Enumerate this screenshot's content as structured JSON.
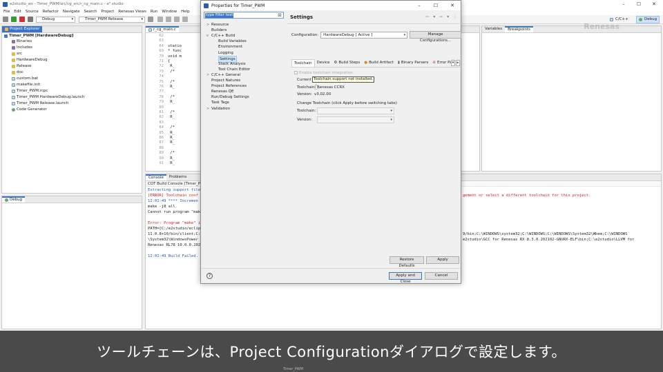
{
  "ide": {
    "title": "e2studio_ws - Timer_PWM/src/cg_src/r_cg_main.c - e² studio",
    "menu": [
      "File",
      "Edit",
      "Source",
      "Refactor",
      "Navigate",
      "Search",
      "Project",
      "Renesas Views",
      "Run",
      "Window",
      "Help"
    ],
    "toolbar": {
      "build_config": "Debug",
      "launch_config": "Timer_PWM Release",
      "perspective_cpp": "C/C++",
      "perspective_debug": "Debug"
    },
    "project_explorer": {
      "tab": "Project Explorer",
      "items": [
        {
          "label": "Timer_PWM [HardwareDebug]",
          "icon": "project-icon"
        },
        {
          "label": "Binaries",
          "icon": "binaries-icon"
        },
        {
          "label": "Includes",
          "icon": "includes-icon"
        },
        {
          "label": "src",
          "icon": "folder-icon"
        },
        {
          "label": "HardwareDebug",
          "icon": "folder-icon"
        },
        {
          "label": "Release",
          "icon": "folder-icon"
        },
        {
          "label": "doc",
          "icon": "folder-icon"
        },
        {
          "label": "custom.bat",
          "icon": "file-icon"
        },
        {
          "label": "makefile.init",
          "icon": "file-icon"
        },
        {
          "label": "Timer_PWM.rcpc",
          "icon": "file-icon"
        },
        {
          "label": "Timer_PWM HardwareDebug.launch",
          "icon": "file-icon"
        },
        {
          "label": "Timer_PWM Release.launch",
          "icon": "file-icon"
        },
        {
          "label": "Code Generator",
          "icon": "gear-icon"
        }
      ]
    },
    "debug_panel": {
      "tab": "Debug"
    },
    "editor": {
      "tab": "r_cg_main.c",
      "lines": [
        {
          "n": "62",
          "code": ""
        },
        {
          "n": "63",
          "code": ""
        },
        {
          "n": "64",
          "code": "statio"
        },
        {
          "n": "69",
          "code": "* func"
        },
        {
          "n": "70",
          "code": "void m"
        },
        {
          "n": "71",
          "code": "{"
        },
        {
          "n": "72",
          "code": "  R_"
        },
        {
          "n": "73",
          "code": "  /*"
        },
        {
          "n": "74",
          "code": ""
        },
        {
          "n": "75",
          "code": "  /*"
        },
        {
          "n": "76",
          "code": "  R_"
        },
        {
          "n": "77",
          "code": ""
        },
        {
          "n": "78",
          "code": "  /*"
        },
        {
          "n": "79",
          "code": "  R_"
        },
        {
          "n": "80",
          "code": ""
        },
        {
          "n": "81",
          "code": "  /*"
        },
        {
          "n": "82",
          "code": "  R_"
        },
        {
          "n": "83",
          "code": ""
        },
        {
          "n": "84",
          "code": "  /*"
        },
        {
          "n": "85",
          "code": "  R_"
        },
        {
          "n": "86",
          "code": "  R_"
        },
        {
          "n": "87",
          "code": "  R_"
        },
        {
          "n": "88",
          "code": ""
        },
        {
          "n": "89",
          "code": "  /*"
        },
        {
          "n": "90",
          "code": "  R_"
        },
        {
          "n": "91",
          "code": "  R_"
        }
      ]
    },
    "right_panel": {
      "tab1": "Variables",
      "tab2": "Breakpoints"
    },
    "console": {
      "tab1": "Console",
      "tab2": "Problems",
      "header": "CDT Build Console [Timer_PWM]",
      "lines": [
        {
          "text": "Extracting support file",
          "style": "blue"
        },
        {
          "text": "[ERROR] Toolchain conf",
          "style": "red"
        },
        {
          "text": "12:01:49 **** Incremen",
          "style": "blue"
        },
        {
          "text": "make -j8 all",
          "style": "black"
        },
        {
          "text": "Cannot run program \"mak",
          "style": "black"
        },
        {
          "text": "",
          "style": "black"
        },
        {
          "text": "Error: Program \"make\" i",
          "style": "red"
        },
        {
          "text": "PATH=[C:/e2studio/eclip",
          "style": "black"
        },
        {
          "text": "11.0.8+10/bin/client;C:",
          "style": "black"
        },
        {
          "text": "\\System32\\WindowsPower",
          "style": "black"
        },
        {
          "text": "Renesas RL78 10.0.0.202",
          "style": "black"
        },
        {
          "text": "",
          "style": "black"
        },
        {
          "text": "12:01:49 Build Failed.",
          "style": "blue"
        }
      ],
      "right_lines": [
        {
          "text": "gement or select a different toolchain for this project.",
          "style": "red"
        },
        {
          "text": "",
          "style": "black"
        },
        {
          "text": "",
          "style": "black"
        },
        {
          "text": "",
          "style": "black"
        },
        {
          "text": "",
          "style": "black"
        },
        {
          "text": "",
          "style": "black"
        },
        {
          "text": "",
          "style": "black"
        },
        {
          "text": "9/bin;C:\\WINDOWS\\system32;C:\\WINDOWS;C:\\WINDOWS\\System32\\Wbem;C:\\WINDOWS",
          "style": "black"
        },
        {
          "text": "e2studio\\GCC for Renesas RX 8.3.0.202102-GNURX-ELF\\bin;C:\\e2studio\\LLVM for",
          "style": "black"
        }
      ]
    },
    "watermark": "Renesas"
  },
  "dialog": {
    "title": "Properties for Timer_PWM",
    "filter_value": "type filter text",
    "nav": [
      {
        "label": "Resource",
        "chev": ">",
        "indent": 0
      },
      {
        "label": "Builders",
        "chev": "",
        "indent": 0
      },
      {
        "label": "C/C++ Build",
        "chev": "v",
        "indent": 0
      },
      {
        "label": "Build Variables",
        "chev": "",
        "indent": 1
      },
      {
        "label": "Environment",
        "chev": "",
        "indent": 1
      },
      {
        "label": "Logging",
        "chev": "",
        "indent": 1
      },
      {
        "label": "Settings",
        "chev": "",
        "indent": 1,
        "selected": true
      },
      {
        "label": "Stack Analysis",
        "chev": "",
        "indent": 1
      },
      {
        "label": "Tool Chain Editor",
        "chev": "",
        "indent": 1
      },
      {
        "label": "C/C++ General",
        "chev": ">",
        "indent": 0
      },
      {
        "label": "Project Natures",
        "chev": "",
        "indent": 0
      },
      {
        "label": "Project References",
        "chev": "",
        "indent": 0
      },
      {
        "label": "Renesas QE",
        "chev": "",
        "indent": 0
      },
      {
        "label": "Run/Debug Settings",
        "chev": "",
        "indent": 0
      },
      {
        "label": "Task Tags",
        "chev": "",
        "indent": 0
      },
      {
        "label": "Validation",
        "chev": ">",
        "indent": 0
      }
    ],
    "page": {
      "title": "Settings",
      "configuration_label": "Configuration:",
      "configuration_value": "HardwareDebug  [ Active ]",
      "manage_button": "Manage Configurations...",
      "tabs": [
        "Toolchain",
        "Device",
        "Build Steps",
        "Build Artifact",
        "Binary Parsers",
        "Error Pa"
      ],
      "enable_integration": "Enable toolchain integration",
      "current_label": "Current",
      "tooltip": "Toolchain support not installed.",
      "toolchain_label": "Toolchain:",
      "toolchain_value": "Renesas CCRX",
      "version_label": "Version:",
      "version_value": "v3.02.00",
      "change_label": "Change Toolchain (click Apply before switching tabs)",
      "restore_button": "Restore Defaults",
      "apply_button": "Apply"
    },
    "footer": {
      "apply_close": "Apply and Close",
      "cancel": "Cancel"
    }
  },
  "subtitle": "ツールチェーンは、Project Configurationダイアログで設定します。",
  "taskbar_hint": "Timer_PWM"
}
